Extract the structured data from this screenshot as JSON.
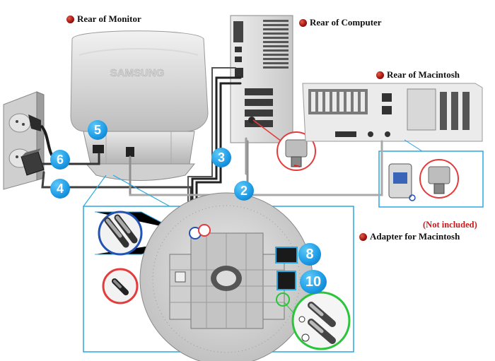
{
  "labels": {
    "rear_monitor": "Rear of Monitor",
    "rear_computer": "Rear of Computer",
    "rear_macintosh": "Rear of  Macintosh",
    "adapter_mac": "Adapter for Macintosh",
    "not_included": "(Not included)",
    "brand": "SAMSUNG"
  },
  "badges": {
    "b2": "2",
    "b3": "3",
    "b4": "4",
    "b5": "5",
    "b6": "6",
    "b8": "8",
    "b10": "10"
  },
  "colors": {
    "badge_blue": "#1f9ee8",
    "highlight_box": "#29a9e1",
    "not_included_red": "#d01818",
    "bullet_red": "#a3150f"
  }
}
